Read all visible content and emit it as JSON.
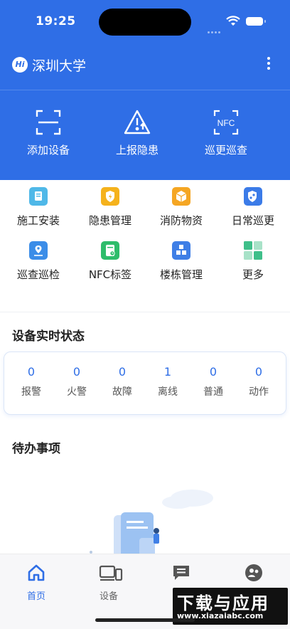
{
  "status_bar": {
    "time": "19:25"
  },
  "header": {
    "badge": "Hi",
    "org_name": "深圳大学"
  },
  "quick_actions": [
    {
      "label": "添加设备",
      "icon": "scan-icon"
    },
    {
      "label": "上报隐患",
      "icon": "warning-upload-icon"
    },
    {
      "label": "巡更巡查",
      "icon": "nfc-icon",
      "icon_text": "NFC"
    }
  ],
  "menu": [
    {
      "label": "施工安装",
      "icon": "construction-icon",
      "color": "#4fb8e8"
    },
    {
      "label": "隐患管理",
      "icon": "hazard-shield-icon",
      "color": "#f5b21c"
    },
    {
      "label": "消防物资",
      "icon": "supplies-box-icon",
      "color": "#f5a623"
    },
    {
      "label": "日常巡更",
      "icon": "patrol-shield-icon",
      "color": "#3b7be8"
    },
    {
      "label": "巡查巡检",
      "icon": "route-map-icon",
      "color": "#3b8de8"
    },
    {
      "label": "NFC标签",
      "icon": "nfc-tag-icon",
      "color": "#2ebd6b"
    },
    {
      "label": "楼栋管理",
      "icon": "building-cubes-icon",
      "color": "#3f7fe6"
    },
    {
      "label": "更多",
      "icon": "more-grid-icon",
      "color": "#3fbf8a"
    }
  ],
  "device_status": {
    "title": "设备实时状态",
    "items": [
      {
        "value": "0",
        "label": "报警"
      },
      {
        "value": "0",
        "label": "火警"
      },
      {
        "value": "0",
        "label": "故障"
      },
      {
        "value": "1",
        "label": "离线"
      },
      {
        "value": "0",
        "label": "普通"
      },
      {
        "value": "0",
        "label": "动作"
      }
    ]
  },
  "todo": {
    "title": "待办事项"
  },
  "tabs": [
    {
      "label": "首页",
      "icon": "home-icon",
      "active": true
    },
    {
      "label": "设备",
      "icon": "devices-icon",
      "active": false
    },
    {
      "label": "",
      "icon": "message-icon",
      "active": false
    },
    {
      "label": "",
      "icon": "user-icon",
      "active": false
    }
  ],
  "watermark": {
    "big": "下载与应用",
    "small": "www.xiazaiabc.com"
  },
  "colors": {
    "primary": "#2f6ee6",
    "accent_text": "#2f6ee6"
  }
}
